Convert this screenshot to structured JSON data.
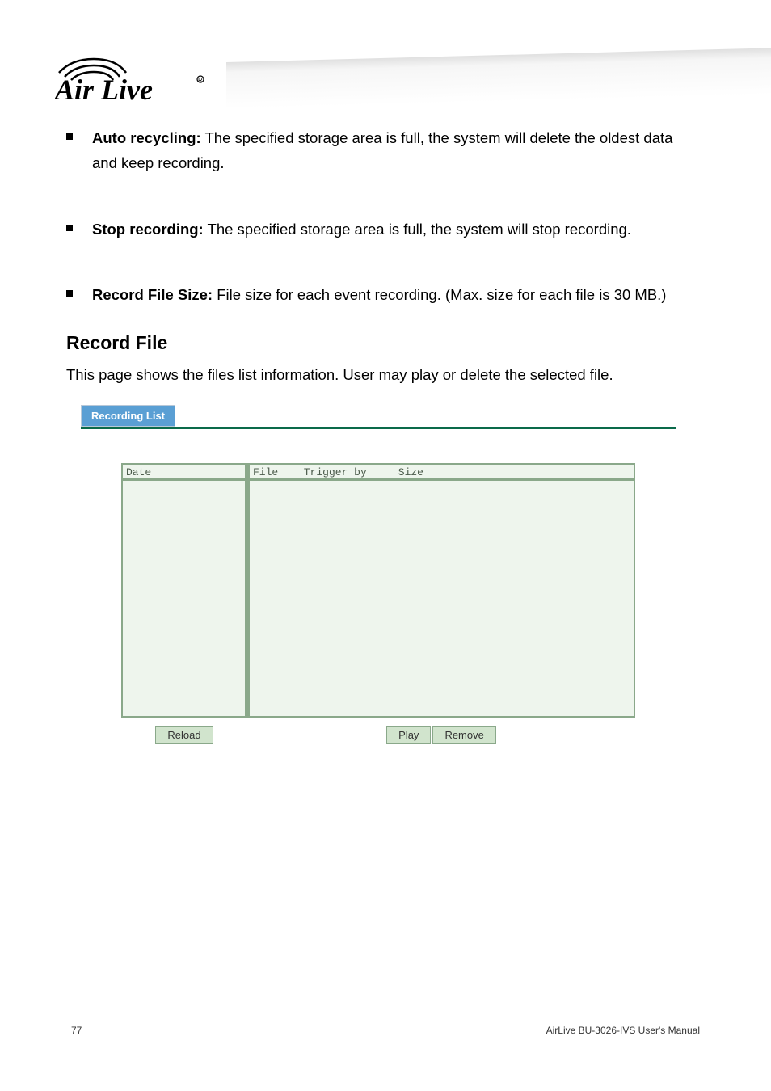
{
  "bullets": [
    {
      "title": "Auto recycling:",
      "body": " The specified storage area is full, the system will delete the oldest data and keep recording."
    },
    {
      "title": "Stop recording:",
      "body": " The specified storage area is full, the system will stop recording."
    },
    {
      "title": "Record File Size:",
      "body": " File size for each event recording. (Max. size for each file is 30 MB.)"
    }
  ],
  "section": {
    "title": "Record File",
    "desc": "This page shows the files list information. User may play or delete the selected file."
  },
  "panel": {
    "tab_label": "Recording List",
    "headers": {
      "date": "Date",
      "file": "File",
      "trigger": "Trigger by",
      "size": "Size"
    },
    "buttons": {
      "reload": "Reload",
      "play": "Play",
      "remove": "Remove"
    }
  },
  "footer": {
    "page": "77",
    "text": "AirLive BU-3026-IVS User's Manual"
  }
}
